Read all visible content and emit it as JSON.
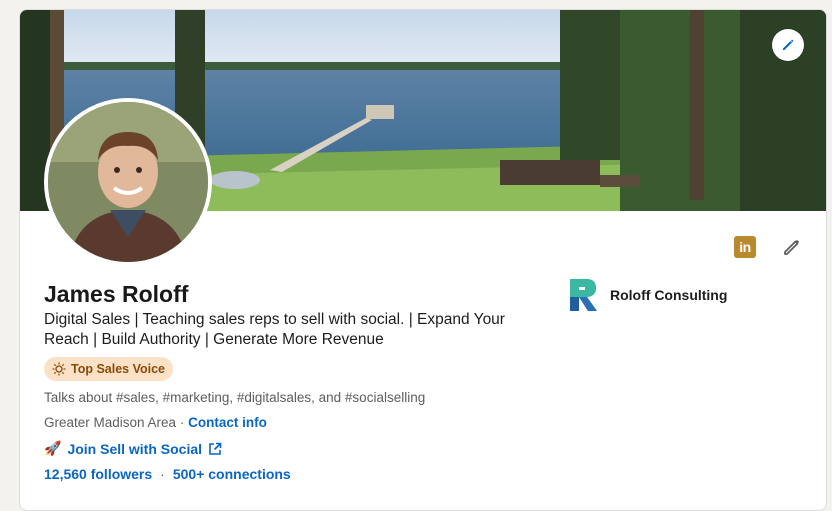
{
  "profile": {
    "name": "James Roloff",
    "headline": "Digital Sales | Teaching sales reps to sell with social. | Expand Your Reach | Build Authority | Generate More Revenue",
    "badge_label": "Top Sales Voice",
    "talks_about": "Talks about #sales, #marketing, #digitalsales, and #socialselling",
    "location": "Greater Madison Area",
    "location_separator": " · ",
    "contact_info_label": "Contact info",
    "join_emoji": "🚀",
    "join_label": "Join Sell with Social",
    "followers": "12,560 followers",
    "stats_separator": "·",
    "connections": "500+ connections"
  },
  "company": {
    "name": "Roloff Consulting",
    "logo_letter": "R"
  },
  "icons": {
    "linkedin": "linkedin-icon",
    "edit": "pencil-icon",
    "badge": "sun-icon",
    "external": "external-link-icon"
  },
  "colors": {
    "link": "#0a66c2",
    "badge_bg": "#fbe1c5",
    "badge_text": "#8a4b08",
    "linkedin_icon": "#b8892f"
  }
}
